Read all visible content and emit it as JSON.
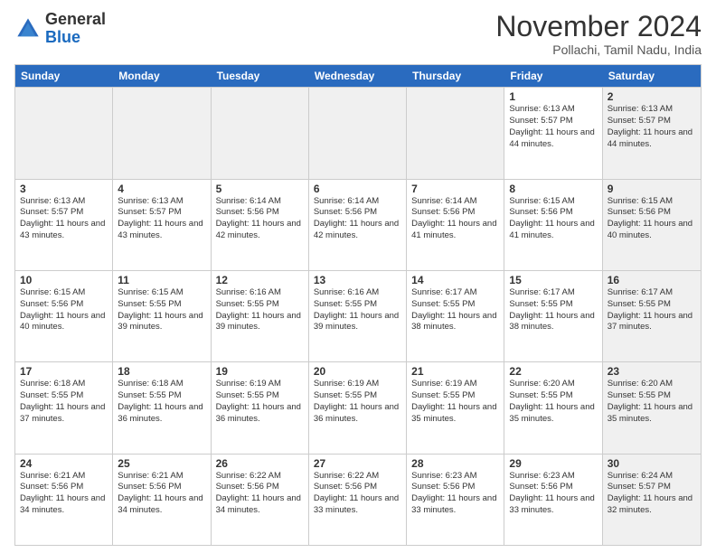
{
  "logo": {
    "general": "General",
    "blue": "Blue"
  },
  "header": {
    "month": "November 2024",
    "location": "Pollachi, Tamil Nadu, India"
  },
  "days": [
    "Sunday",
    "Monday",
    "Tuesday",
    "Wednesday",
    "Thursday",
    "Friday",
    "Saturday"
  ],
  "rows": [
    [
      {
        "num": "",
        "info": "",
        "shaded": true
      },
      {
        "num": "",
        "info": "",
        "shaded": true
      },
      {
        "num": "",
        "info": "",
        "shaded": true
      },
      {
        "num": "",
        "info": "",
        "shaded": true
      },
      {
        "num": "",
        "info": "",
        "shaded": true
      },
      {
        "num": "1",
        "info": "Sunrise: 6:13 AM\nSunset: 5:57 PM\nDaylight: 11 hours and 44 minutes.",
        "shaded": false
      },
      {
        "num": "2",
        "info": "Sunrise: 6:13 AM\nSunset: 5:57 PM\nDaylight: 11 hours and 44 minutes.",
        "shaded": true
      }
    ],
    [
      {
        "num": "3",
        "info": "Sunrise: 6:13 AM\nSunset: 5:57 PM\nDaylight: 11 hours and 43 minutes.",
        "shaded": false
      },
      {
        "num": "4",
        "info": "Sunrise: 6:13 AM\nSunset: 5:57 PM\nDaylight: 11 hours and 43 minutes.",
        "shaded": false
      },
      {
        "num": "5",
        "info": "Sunrise: 6:14 AM\nSunset: 5:56 PM\nDaylight: 11 hours and 42 minutes.",
        "shaded": false
      },
      {
        "num": "6",
        "info": "Sunrise: 6:14 AM\nSunset: 5:56 PM\nDaylight: 11 hours and 42 minutes.",
        "shaded": false
      },
      {
        "num": "7",
        "info": "Sunrise: 6:14 AM\nSunset: 5:56 PM\nDaylight: 11 hours and 41 minutes.",
        "shaded": false
      },
      {
        "num": "8",
        "info": "Sunrise: 6:15 AM\nSunset: 5:56 PM\nDaylight: 11 hours and 41 minutes.",
        "shaded": false
      },
      {
        "num": "9",
        "info": "Sunrise: 6:15 AM\nSunset: 5:56 PM\nDaylight: 11 hours and 40 minutes.",
        "shaded": true
      }
    ],
    [
      {
        "num": "10",
        "info": "Sunrise: 6:15 AM\nSunset: 5:56 PM\nDaylight: 11 hours and 40 minutes.",
        "shaded": false
      },
      {
        "num": "11",
        "info": "Sunrise: 6:15 AM\nSunset: 5:55 PM\nDaylight: 11 hours and 39 minutes.",
        "shaded": false
      },
      {
        "num": "12",
        "info": "Sunrise: 6:16 AM\nSunset: 5:55 PM\nDaylight: 11 hours and 39 minutes.",
        "shaded": false
      },
      {
        "num": "13",
        "info": "Sunrise: 6:16 AM\nSunset: 5:55 PM\nDaylight: 11 hours and 39 minutes.",
        "shaded": false
      },
      {
        "num": "14",
        "info": "Sunrise: 6:17 AM\nSunset: 5:55 PM\nDaylight: 11 hours and 38 minutes.",
        "shaded": false
      },
      {
        "num": "15",
        "info": "Sunrise: 6:17 AM\nSunset: 5:55 PM\nDaylight: 11 hours and 38 minutes.",
        "shaded": false
      },
      {
        "num": "16",
        "info": "Sunrise: 6:17 AM\nSunset: 5:55 PM\nDaylight: 11 hours and 37 minutes.",
        "shaded": true
      }
    ],
    [
      {
        "num": "17",
        "info": "Sunrise: 6:18 AM\nSunset: 5:55 PM\nDaylight: 11 hours and 37 minutes.",
        "shaded": false
      },
      {
        "num": "18",
        "info": "Sunrise: 6:18 AM\nSunset: 5:55 PM\nDaylight: 11 hours and 36 minutes.",
        "shaded": false
      },
      {
        "num": "19",
        "info": "Sunrise: 6:19 AM\nSunset: 5:55 PM\nDaylight: 11 hours and 36 minutes.",
        "shaded": false
      },
      {
        "num": "20",
        "info": "Sunrise: 6:19 AM\nSunset: 5:55 PM\nDaylight: 11 hours and 36 minutes.",
        "shaded": false
      },
      {
        "num": "21",
        "info": "Sunrise: 6:19 AM\nSunset: 5:55 PM\nDaylight: 11 hours and 35 minutes.",
        "shaded": false
      },
      {
        "num": "22",
        "info": "Sunrise: 6:20 AM\nSunset: 5:55 PM\nDaylight: 11 hours and 35 minutes.",
        "shaded": false
      },
      {
        "num": "23",
        "info": "Sunrise: 6:20 AM\nSunset: 5:55 PM\nDaylight: 11 hours and 35 minutes.",
        "shaded": true
      }
    ],
    [
      {
        "num": "24",
        "info": "Sunrise: 6:21 AM\nSunset: 5:56 PM\nDaylight: 11 hours and 34 minutes.",
        "shaded": false
      },
      {
        "num": "25",
        "info": "Sunrise: 6:21 AM\nSunset: 5:56 PM\nDaylight: 11 hours and 34 minutes.",
        "shaded": false
      },
      {
        "num": "26",
        "info": "Sunrise: 6:22 AM\nSunset: 5:56 PM\nDaylight: 11 hours and 34 minutes.",
        "shaded": false
      },
      {
        "num": "27",
        "info": "Sunrise: 6:22 AM\nSunset: 5:56 PM\nDaylight: 11 hours and 33 minutes.",
        "shaded": false
      },
      {
        "num": "28",
        "info": "Sunrise: 6:23 AM\nSunset: 5:56 PM\nDaylight: 11 hours and 33 minutes.",
        "shaded": false
      },
      {
        "num": "29",
        "info": "Sunrise: 6:23 AM\nSunset: 5:56 PM\nDaylight: 11 hours and 33 minutes.",
        "shaded": false
      },
      {
        "num": "30",
        "info": "Sunrise: 6:24 AM\nSunset: 5:57 PM\nDaylight: 11 hours and 32 minutes.",
        "shaded": true
      }
    ]
  ]
}
